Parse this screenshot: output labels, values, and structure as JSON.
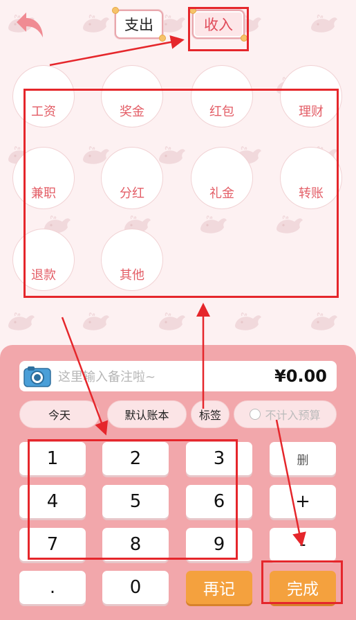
{
  "header": {
    "back_icon": "back-arrow-icon",
    "tab_expense": "支出",
    "tab_income": "收入"
  },
  "categories": [
    {
      "label": "工资"
    },
    {
      "label": "奖金"
    },
    {
      "label": "红包"
    },
    {
      "label": "理财"
    },
    {
      "label": "兼职"
    },
    {
      "label": "分红"
    },
    {
      "label": "礼金"
    },
    {
      "label": "转账"
    },
    {
      "label": "退款"
    },
    {
      "label": "其他"
    }
  ],
  "note": {
    "camera_icon": "camera-icon",
    "placeholder": "这里输入备注啦~",
    "amount": "¥0.00"
  },
  "options": {
    "date": "今天",
    "account_book": "默认账本",
    "tag": "标签",
    "exclude_budget": "不计入预算"
  },
  "keypad": {
    "k1": "1",
    "k2": "2",
    "k3": "3",
    "del": "删",
    "k4": "4",
    "k5": "5",
    "k6": "6",
    "plus": "+",
    "k7": "7",
    "k8": "8",
    "k9": "9",
    "minus": "-",
    "dot": ".",
    "k0": "0",
    "again": "再记",
    "done": "完成"
  },
  "colors": {
    "accent_red": "#e35d66",
    "panel_pink": "#f2a7ab",
    "orange": "#f4a13e",
    "annotation_red": "#e5262b"
  }
}
